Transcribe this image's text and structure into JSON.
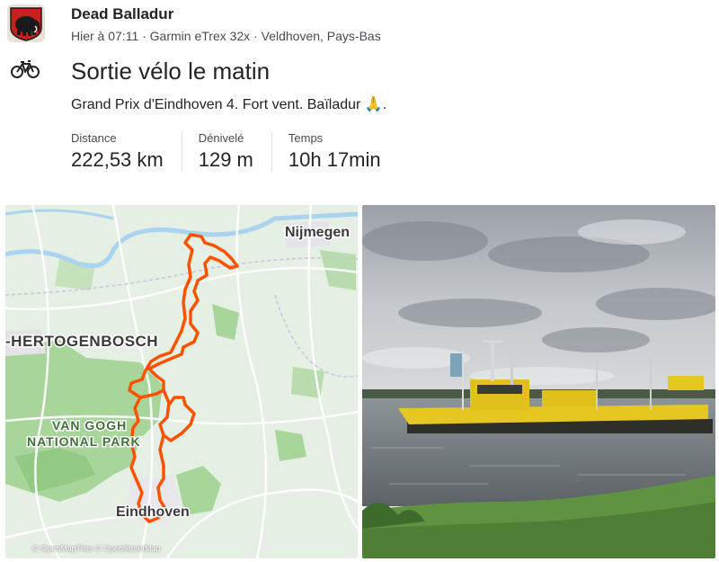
{
  "athlete": {
    "name": "Dead Balladur",
    "meta": "Hier à 07:11 · Garmin eTrex 32x · Veldhoven, Pays-Bas",
    "avatar": "mammoth-logo"
  },
  "activity": {
    "sport_icon": "bike-icon",
    "title": "Sortie vélo le matin",
    "description": "Grand Prix d'Eindhoven 4. Fort vent. Baïladur 🙏."
  },
  "stats": [
    {
      "label": "Distance",
      "value": "222,53 km"
    },
    {
      "label": "Dénivelé",
      "value": "129 m"
    },
    {
      "label": "Temps",
      "value": "10h 17min"
    }
  ],
  "map": {
    "labels": {
      "nijmegen": "Nijmegen",
      "hertogenbosch": "-HERTOGENBOSCH",
      "park_line1": "VAN GOGH",
      "park_line2": "NATIONAL PARK",
      "eindhoven": "Eindhoven"
    },
    "attribution": "© OpenMapTiles © OpenStreetMap",
    "route_color": "#fc5200"
  },
  "photo": {
    "subject": "yellow-ferry-on-river"
  }
}
